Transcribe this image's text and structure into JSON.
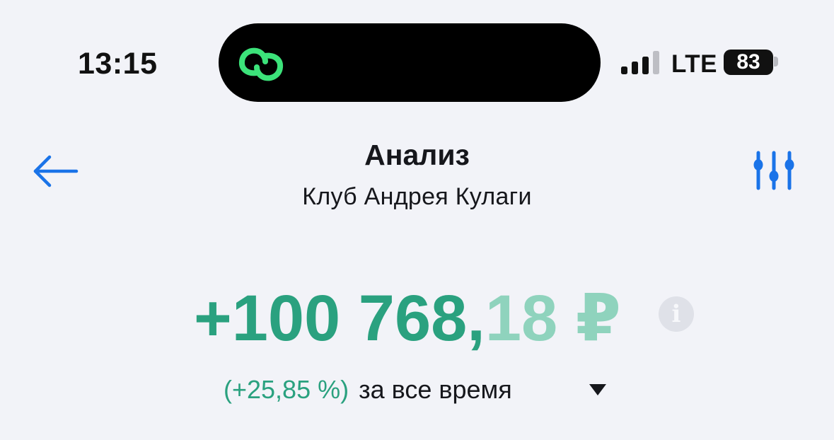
{
  "status_bar": {
    "time": "13:15",
    "network": "LTE",
    "battery": "83",
    "island_icon": "chain-link-icon"
  },
  "header": {
    "title": "Анализ",
    "subtitle": "Клуб Андрея Кулаги",
    "back_icon": "arrow-left-icon",
    "filter_icon": "sliders-icon"
  },
  "summary": {
    "total_integer": "+100 768,",
    "total_fraction": "18 ₽",
    "percent": "(+25,85 %)",
    "period": "за все время",
    "info_glyph": "i"
  },
  "colors": {
    "accent_blue": "#1a73e8",
    "profit_green": "#2aa17f",
    "profit_green_light": "#8fd3bd",
    "island_green": "#3ce27a",
    "background": "#f2f3f8"
  }
}
